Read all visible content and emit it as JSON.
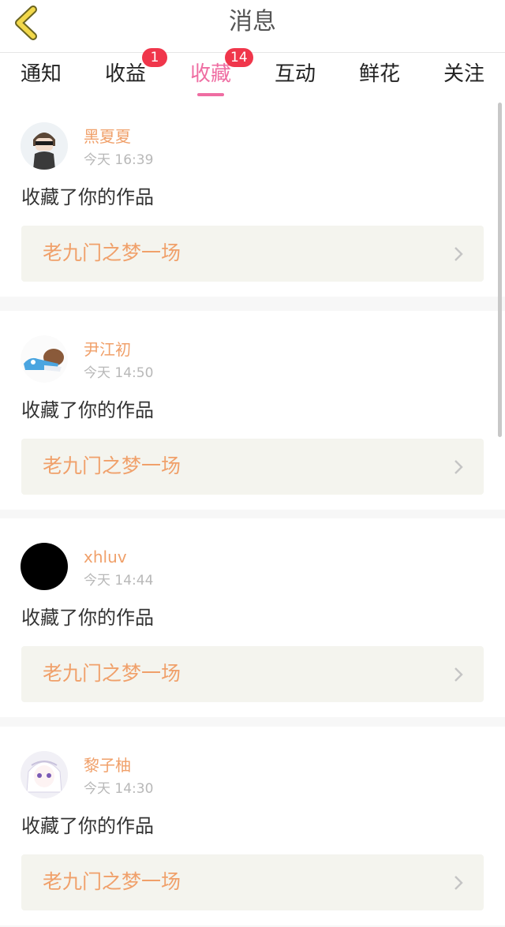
{
  "header": {
    "title": "消息",
    "back_icon": "chevron-left-icon",
    "back_icon_color": "#f2d84a"
  },
  "tabs": [
    {
      "label": "通知",
      "badge": null,
      "active": false
    },
    {
      "label": "收益",
      "badge": "1",
      "active": false
    },
    {
      "label": "收藏",
      "badge": "14",
      "active": true
    },
    {
      "label": "互动",
      "badge": null,
      "active": false
    },
    {
      "label": "鲜花",
      "badge": null,
      "active": false
    },
    {
      "label": "关注",
      "badge": null,
      "active": false
    }
  ],
  "colors": {
    "accent": "#ef6da2",
    "badge": "#f0364b",
    "username": "#f0a06a",
    "work_title": "#f0a06a",
    "work_box_bg": "#f4f4ee"
  },
  "notifications": [
    {
      "user": "黑夏夏",
      "time": "今天 16:39",
      "action": "收藏了你的作品",
      "work_title": "老九门之梦一场"
    },
    {
      "user": "尹江初",
      "time": "今天 14:50",
      "action": "收藏了你的作品",
      "work_title": "老九门之梦一场"
    },
    {
      "user": "xhluv",
      "time": "今天 14:44",
      "action": "收藏了你的作品",
      "work_title": "老九门之梦一场"
    },
    {
      "user": "黎子柚",
      "time": "今天 14:30",
      "action": "收藏了你的作品",
      "work_title": "老九门之梦一场"
    }
  ]
}
